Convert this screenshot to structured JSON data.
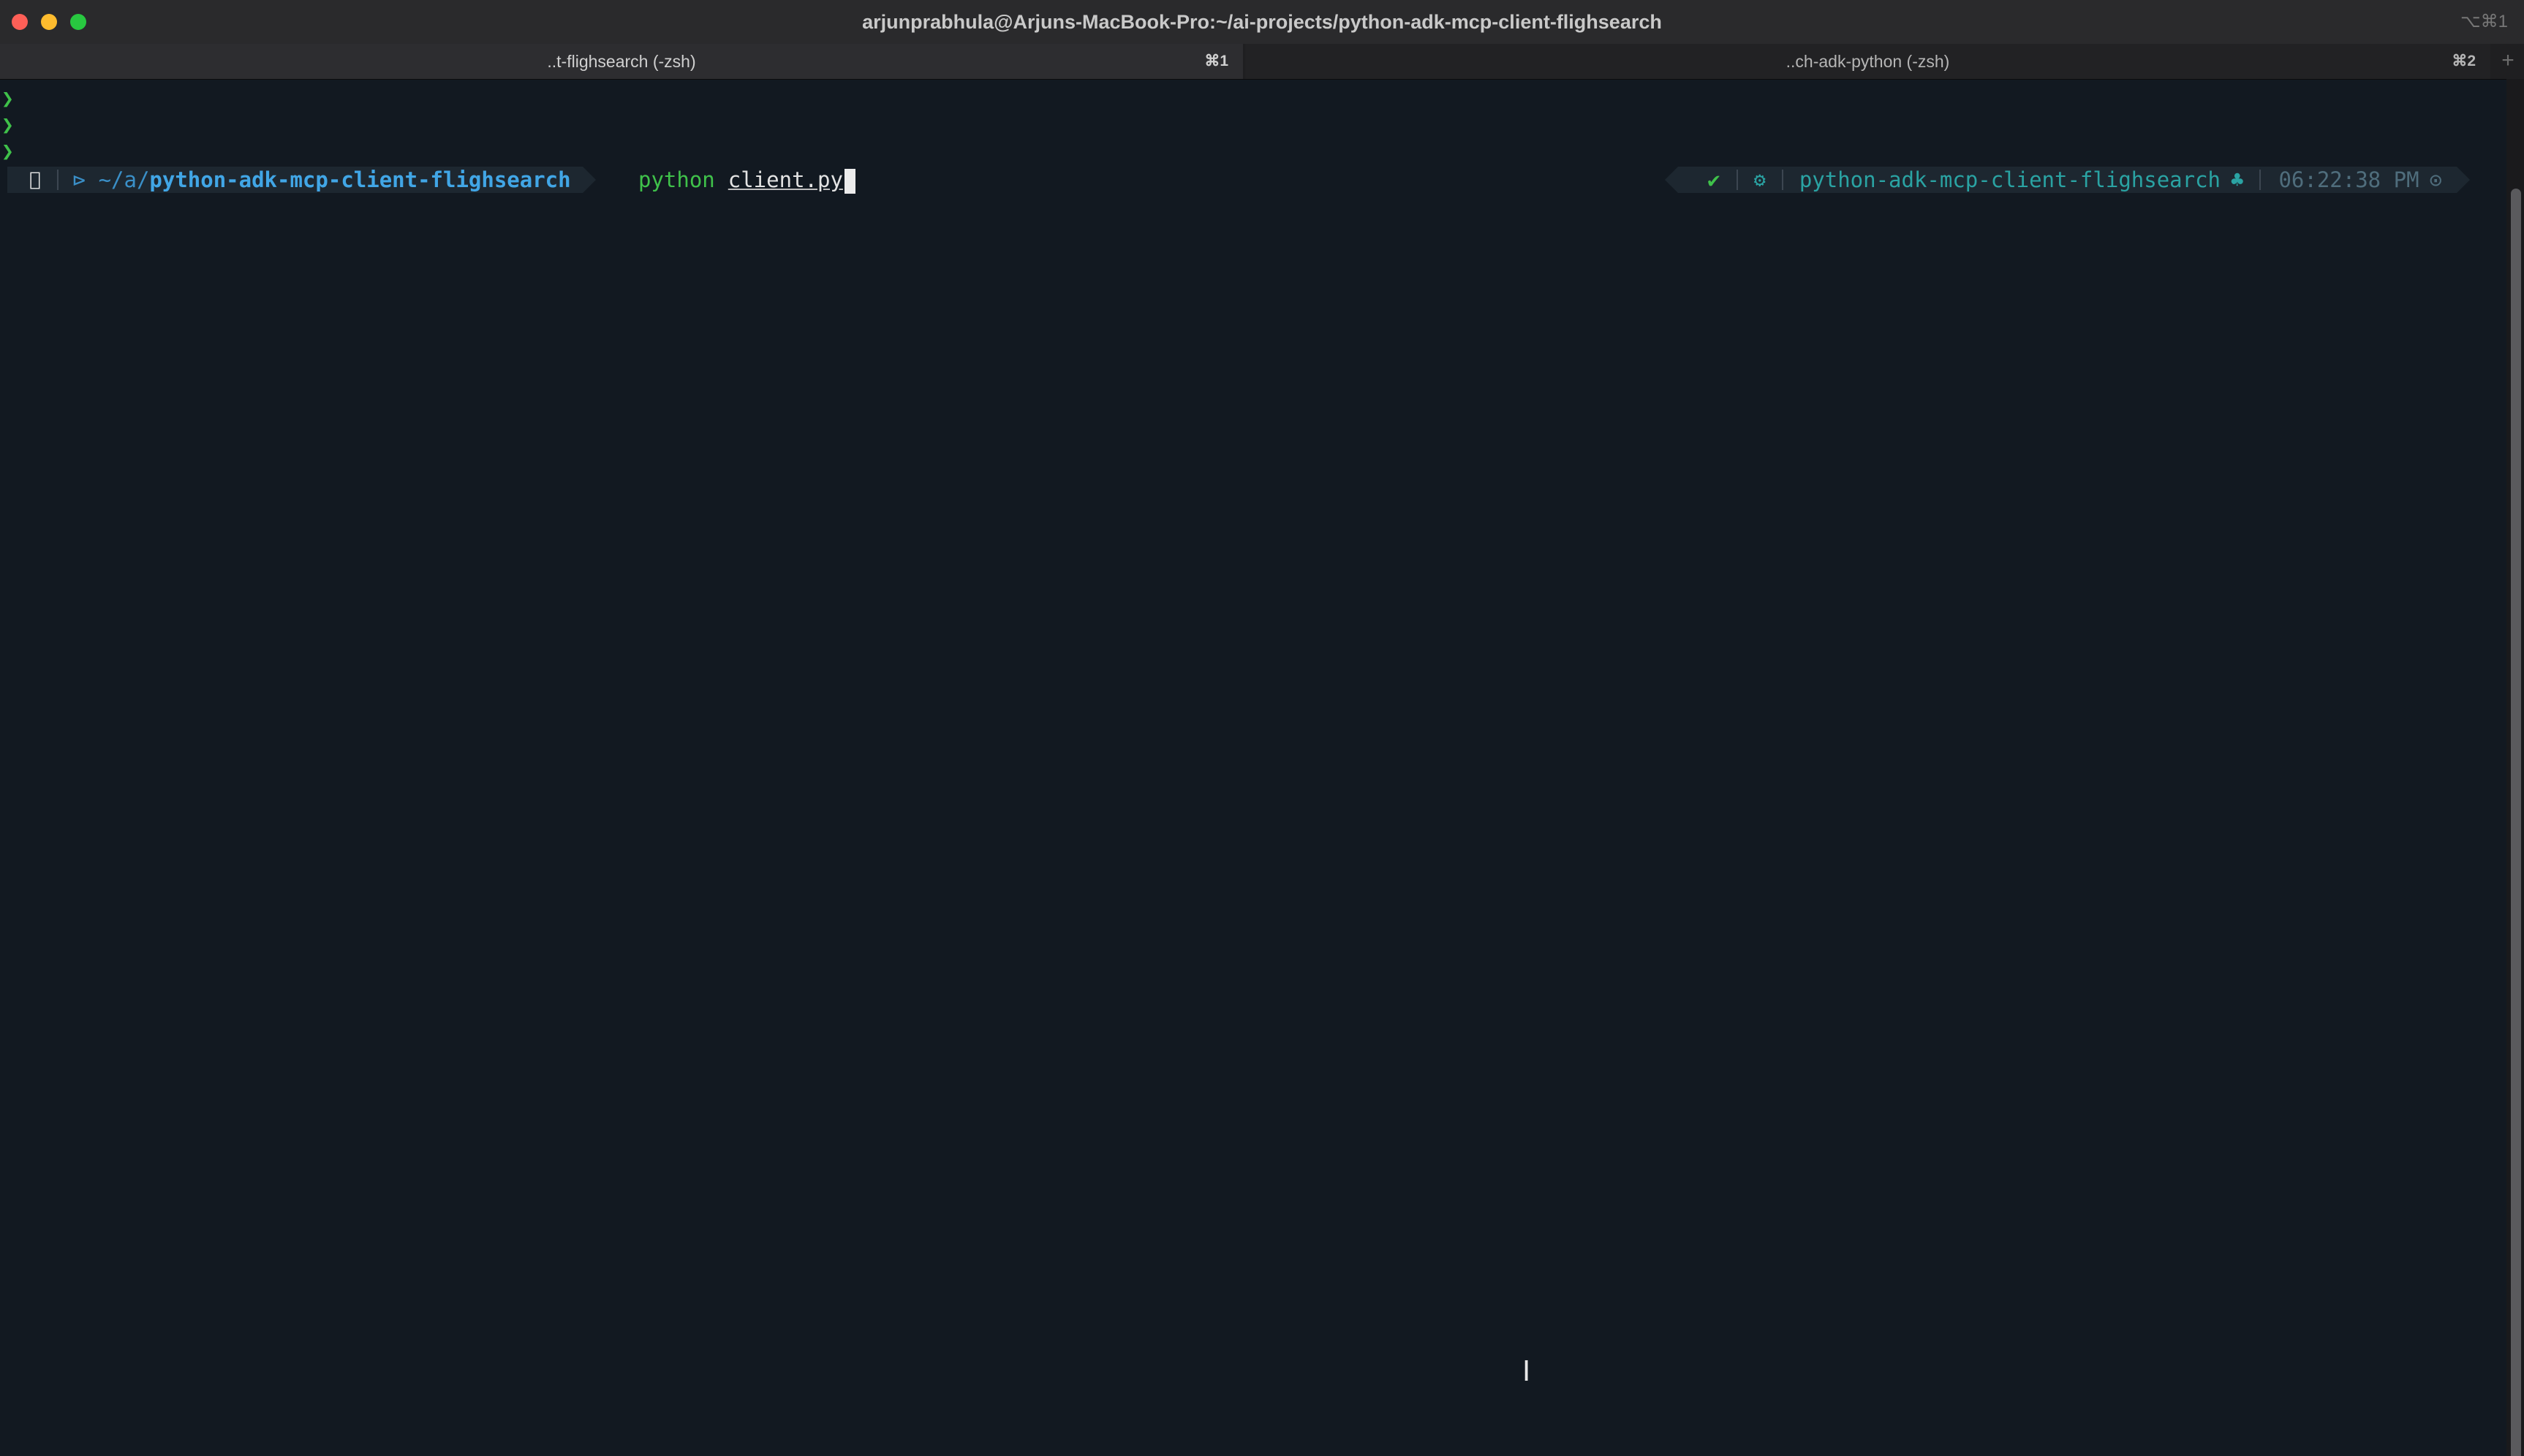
{
  "window": {
    "title": "arjunprabhula@Arjuns-MacBook-Pro:~/ai-projects/python-adk-mcp-client-flighsearch",
    "title_shortcut": "⌥⌘1"
  },
  "tabs": [
    {
      "label": "..t-flighsearch (-zsh)",
      "shortcut": "⌘1",
      "active": true
    },
    {
      "label": "..ch-adk-python (-zsh)",
      "shortcut": "⌘2",
      "active": false
    }
  ],
  "new_tab_label": "+",
  "terminal": {
    "previous_prompts": [
      "❯",
      "❯",
      "❯"
    ],
    "prompt": {
      "apple_icon": "",
      "path_prefix": "⊳ ~/a/",
      "path_dir": "python-adk-mcp-client-flighsearch",
      "command": "python",
      "argument": "client.py"
    },
    "status": {
      "exit_ok": "✔",
      "gear_icon": "⚙",
      "env_name": "python-adk-mcp-client-flighsearch",
      "env_icon": "♣",
      "time": "06:22:38 PM",
      "clock_icon": "⊙"
    }
  },
  "cursor_icon": "I"
}
